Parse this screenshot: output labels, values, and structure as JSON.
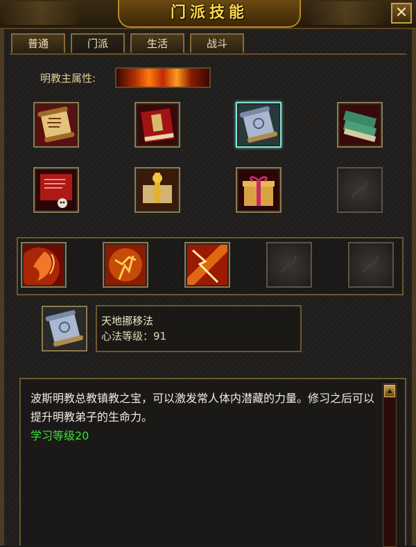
{
  "window": {
    "title": "门派技能",
    "close_glyph": "✕"
  },
  "tabs": [
    {
      "label": "普通",
      "active": false
    },
    {
      "label": "门派",
      "active": true
    },
    {
      "label": "生活",
      "active": false
    },
    {
      "label": "战斗",
      "active": false
    }
  ],
  "attribute": {
    "label": "明教主属性:",
    "icon": "fire-bar-icon"
  },
  "passive_skills": [
    {
      "icon": "scroll-icon"
    },
    {
      "icon": "red-book-icon"
    },
    {
      "icon": "blue-scroll-icon",
      "selected": true
    },
    {
      "icon": "green-books-icon"
    },
    {
      "icon": "red-scroll-skull-icon"
    },
    {
      "icon": "golden-key-scroll-icon"
    },
    {
      "icon": "gift-box-icon"
    },
    {
      "icon": "empty-slot-icon",
      "empty": true
    }
  ],
  "active_skills": [
    {
      "icon": "flame-face-icon"
    },
    {
      "icon": "flame-warrior-icon"
    },
    {
      "icon": "lightning-strike-icon"
    },
    {
      "icon": "empty-slot-icon",
      "empty": true
    },
    {
      "icon": "empty-slot-icon",
      "empty": true
    }
  ],
  "selected_skill": {
    "icon": "blue-scroll-icon",
    "name": "天地挪移法",
    "level_text": "心法等级：91"
  },
  "description": {
    "text": "波斯明教总教镇教之宝，可以激发常人体内潜藏的力量。修习之后可以提升明教弟子的生命力。",
    "requirement": "学习等级20"
  },
  "colors": {
    "accent_gold": "#ffd84a",
    "requirement_green": "#39e23a",
    "selected_border": "#7fe0d8"
  }
}
